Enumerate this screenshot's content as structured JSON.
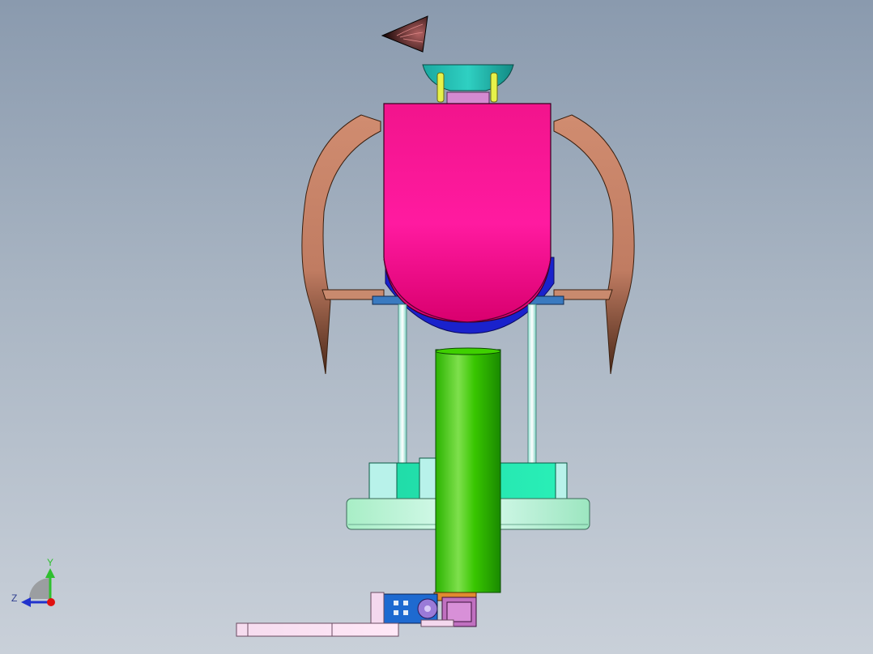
{
  "viewport": {
    "background_top": "#8a9aae",
    "background_bottom": "#c9d0d9"
  },
  "triad": {
    "y_label": "Y",
    "z_label": "Z",
    "y_color": "#2fbf2f",
    "z_color": "#2233cc",
    "origin_color": "#e01010"
  },
  "model": {
    "shell_color": "#ff1a9a",
    "arm_color": "#c98a6e",
    "column_color": "#22b300",
    "base_ring_color": "#c8f0d8",
    "base_block_color": "#22e6b0",
    "funnel_color": "#1ea6a0",
    "cone_color": "#2b0b0b",
    "bowl_color": "#1a22cc"
  }
}
